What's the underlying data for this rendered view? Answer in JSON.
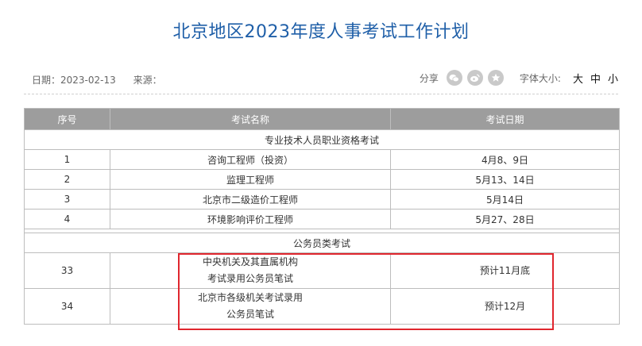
{
  "article": {
    "title": "北京地区2023年度人事考试工作计划",
    "date_label": "日期：2023-02-13",
    "source_label": "来源："
  },
  "tools": {
    "share_label": "分享",
    "font_size_label": "字体大小:",
    "font_sizes": [
      "大",
      "中",
      "小"
    ],
    "icons": [
      "wechat-icon",
      "weibo-icon",
      "star-icon"
    ]
  },
  "table": {
    "headers": [
      "序号",
      "考试名称",
      "考试日期"
    ],
    "sections": [
      {
        "title": "专业技术人员职业资格考试",
        "rows": [
          {
            "no": "1",
            "name": "咨询工程师（投资）",
            "date": "4月8、9日"
          },
          {
            "no": "2",
            "name": "监理工程师",
            "date": "5月13、14日"
          },
          {
            "no": "3",
            "name": "北京市二级造价工程师",
            "date": "5月14日"
          },
          {
            "no": "4",
            "name": "环境影响评价工程师",
            "date": "5月27、28日"
          }
        ]
      },
      {
        "title": "公务员类考试",
        "rows": [
          {
            "no": "33",
            "name_line1": "中央机关及其直属机构",
            "name_line2": "考试录用公务员笔试",
            "date": "预计11月底"
          },
          {
            "no": "34",
            "name_line1": "北京市各级机关考试录用",
            "name_line2": "公务员笔试",
            "date": "预计12月"
          }
        ]
      }
    ]
  },
  "colors": {
    "title": "#1f5fa8",
    "header_bg": "#9d9d9d",
    "highlight": "#e0262e"
  }
}
